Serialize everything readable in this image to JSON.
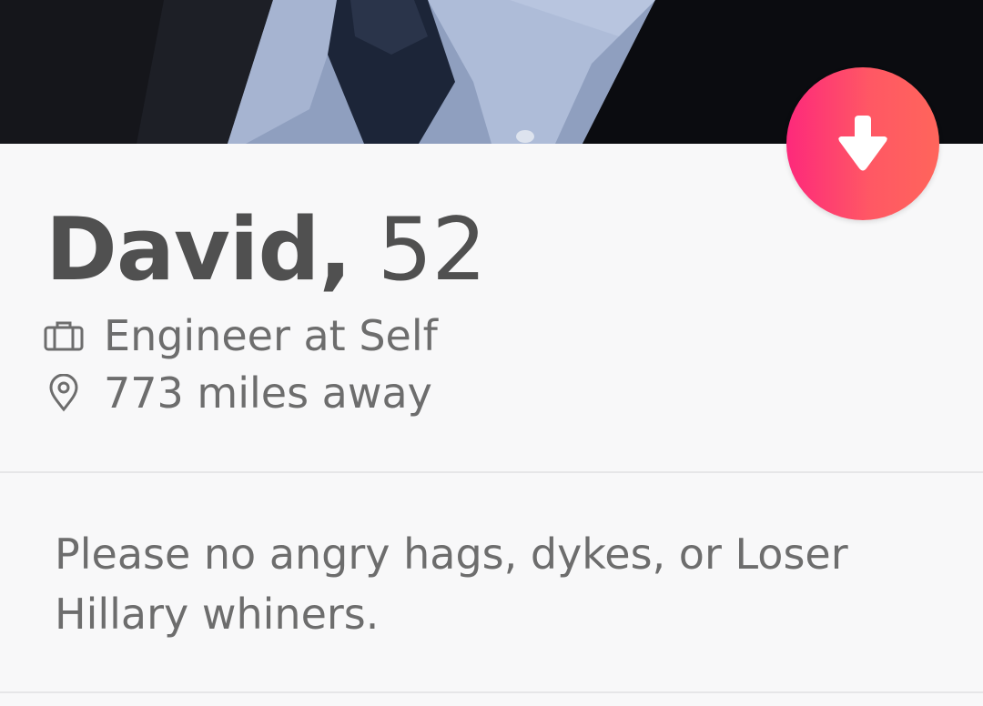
{
  "profile": {
    "name": "David,",
    "age": "52",
    "job": "Engineer at Self",
    "distance": "773 miles away",
    "bio": "Please no angry hags, dykes, or Loser Hillary whiners."
  },
  "photo": {
    "subject": "man in dark suit, light blue button-down shirt and dark tie"
  },
  "icons": {
    "collapse": "arrow-down-icon",
    "job": "briefcase-icon",
    "distance": "location-pin-icon"
  },
  "colors": {
    "accent_start": "#fd297b",
    "accent_end": "#ff655b",
    "text_primary": "#505050",
    "text_secondary": "#6d6d6d",
    "background": "#f8f8f9"
  }
}
